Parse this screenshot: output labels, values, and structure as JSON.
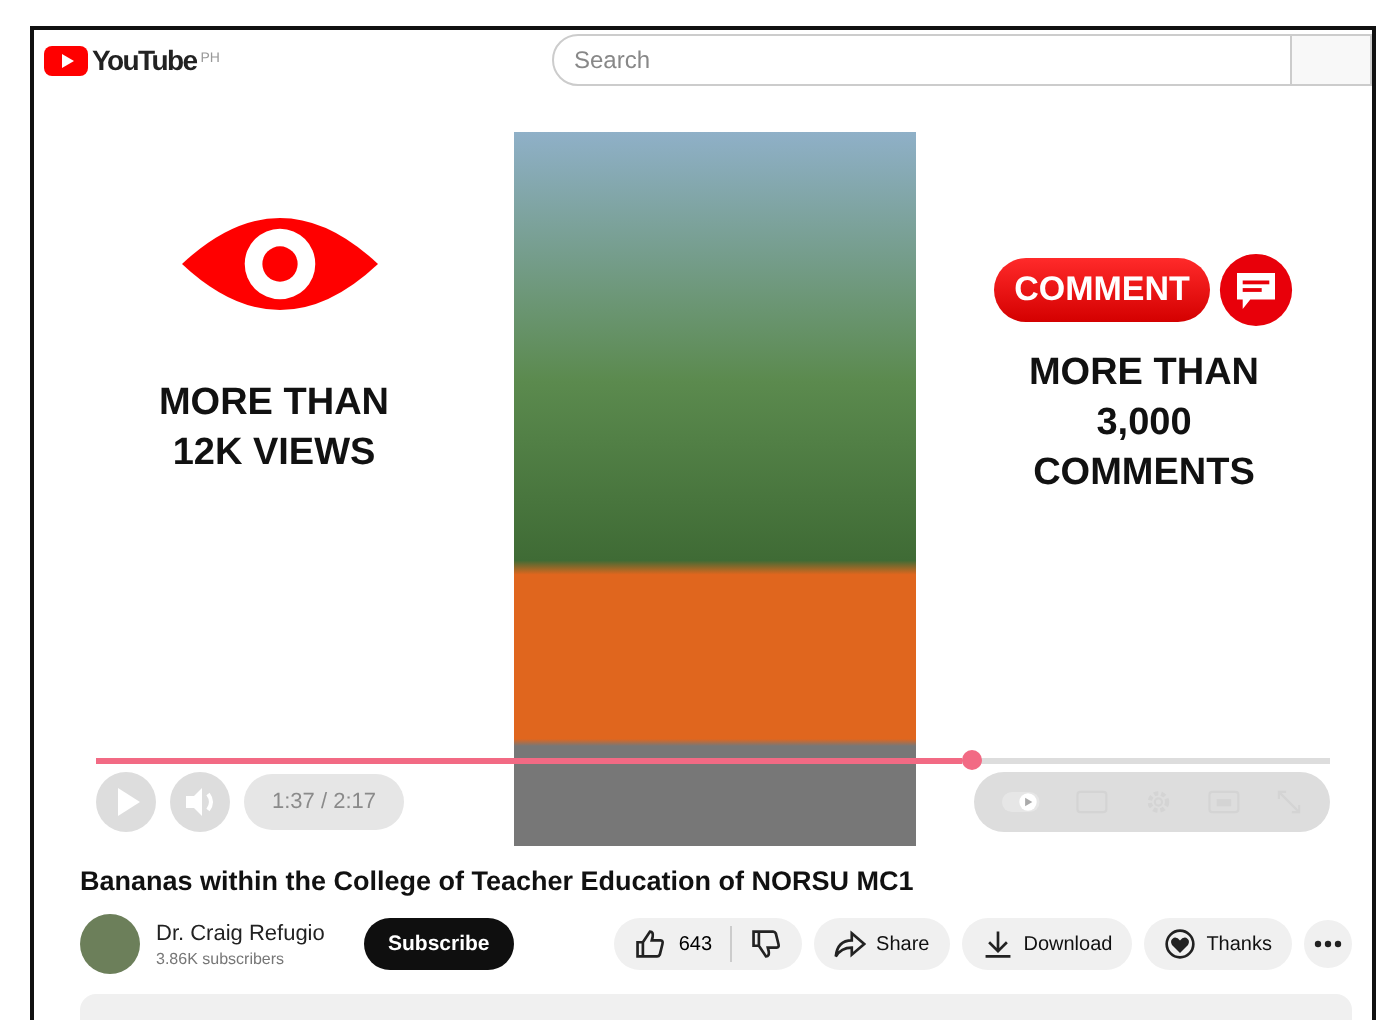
{
  "header": {
    "logo": "YouTube",
    "region": "PH",
    "search": {
      "placeholder": "Search"
    }
  },
  "overlays": {
    "views": {
      "lines": [
        "MORE THAN",
        "12K VIEWS"
      ]
    },
    "comments": {
      "badge": "COMMENT",
      "lines": [
        "MORE THAN",
        "3,000",
        "COMMENTS"
      ]
    }
  },
  "player": {
    "progress": {
      "level": 0.71
    },
    "time": "1:37 / 2:17"
  },
  "video": {
    "title": "Bananas within the College of Teacher Education of NORSU MC1"
  },
  "channel": {
    "name": "Dr. Craig Refugio",
    "subscribers": "3.86K subscribers",
    "subscribe": "Subscribe"
  },
  "like": {
    "count": "643"
  },
  "actions": [
    {
      "kind": "share",
      "label": "Share"
    },
    {
      "kind": "download",
      "label": "Download"
    },
    {
      "kind": "thanks",
      "label": "Thanks"
    }
  ]
}
